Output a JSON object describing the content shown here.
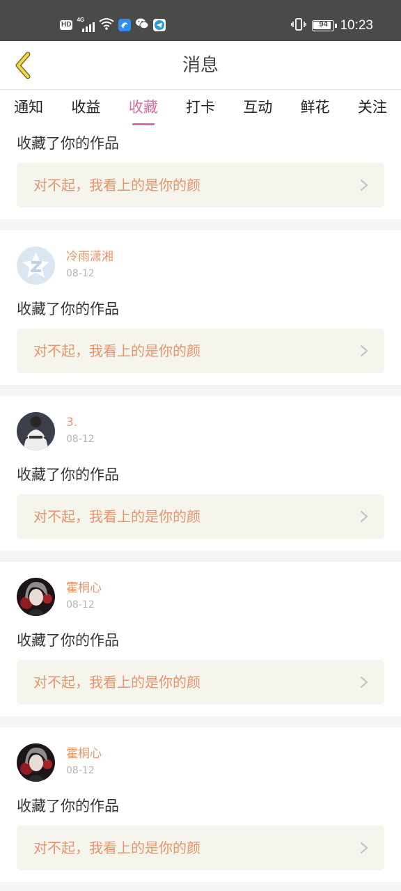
{
  "status_bar": {
    "hd": "HD",
    "network": "4G",
    "battery": "94",
    "battery_level": 0.94,
    "time": "10:23",
    "icons": [
      "hd-icon",
      "signal-4g-icon",
      "wifi-icon",
      "app-notify-icon",
      "wechat-icon",
      "app-telegram-icon",
      "vibrate-icon",
      "battery-icon"
    ]
  },
  "header": {
    "title": "消息",
    "back_icon": "chevron-left-icon"
  },
  "tabs": [
    {
      "label": "通知",
      "active": false
    },
    {
      "label": "收益",
      "active": false
    },
    {
      "label": "收藏",
      "active": true
    },
    {
      "label": "打卡",
      "active": false
    },
    {
      "label": "互动",
      "active": false
    },
    {
      "label": "鲜花",
      "active": false
    },
    {
      "label": "关注",
      "active": false
    }
  ],
  "colors": {
    "accent": "#d86ba3",
    "name": "#e8956a",
    "work_bg": "#f5f5ee"
  },
  "items": [
    {
      "action": "收藏了你的作品",
      "work_title": "对不起，我看上的是你的颜"
    },
    {
      "user": "冷雨潇湘",
      "date": "08-12",
      "avatar": "qq-default-avatar",
      "action": "收藏了你的作品",
      "work_title": "对不起，我看上的是你的颜"
    },
    {
      "user": "3.",
      "date": "08-12",
      "avatar": "person-photo-avatar",
      "action": "收藏了你的作品",
      "work_title": "对不起，我看上的是你的颜"
    },
    {
      "user": "霍桐心",
      "date": "08-12",
      "avatar": "anime-avatar",
      "action": "收藏了你的作品",
      "work_title": "对不起，我看上的是你的颜"
    },
    {
      "user": "霍桐心",
      "date": "08-12",
      "avatar": "anime-avatar",
      "action": "收藏了你的作品",
      "work_title": "对不起，我看上的是你的颜"
    }
  ]
}
